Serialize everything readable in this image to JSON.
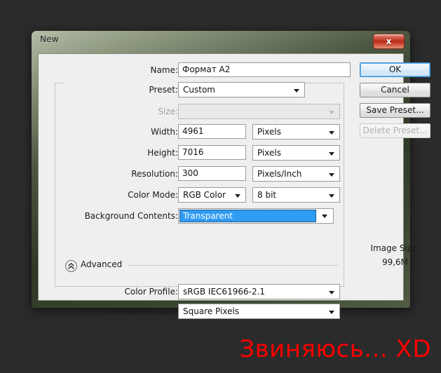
{
  "window": {
    "title": "New",
    "close_label": "x"
  },
  "form": {
    "name": {
      "label": "Name:",
      "value": "Формат А2"
    },
    "preset": {
      "label": "Preset:",
      "value": "Custom"
    },
    "size": {
      "label": "Size:",
      "value": ""
    },
    "width": {
      "label": "Width:",
      "value": "4961",
      "unit": "Pixels"
    },
    "height": {
      "label": "Height:",
      "value": "7016",
      "unit": "Pixels"
    },
    "resolution": {
      "label": "Resolution:",
      "value": "300",
      "unit": "Pixels/Inch"
    },
    "color_mode": {
      "label": "Color Mode:",
      "value": "RGB Color",
      "depth": "8 bit"
    },
    "background_contents": {
      "label": "Background Contents:",
      "value": "Transparent"
    }
  },
  "advanced": {
    "label": "Advanced",
    "color_profile": {
      "label": "Color Profile:",
      "value": "sRGB IEC61966-2.1"
    },
    "pixel_aspect_ratio": {
      "label": "Pixel Aspect Ratio:",
      "value": "Square Pixels"
    }
  },
  "buttons": {
    "ok": "OK",
    "cancel": "Cancel",
    "save_preset": "Save Preset...",
    "delete_preset": "Delete Preset..."
  },
  "image_size": {
    "label": "Image Size:",
    "value": "99,6M"
  },
  "caption": {
    "text": "Звиняюсь... XD"
  },
  "colors": {
    "accent_selection": "#2f9cf4",
    "caption_red": "#fb0000",
    "desktop_bg": "#2b2b2b",
    "close_button_red": "#b92b18"
  }
}
